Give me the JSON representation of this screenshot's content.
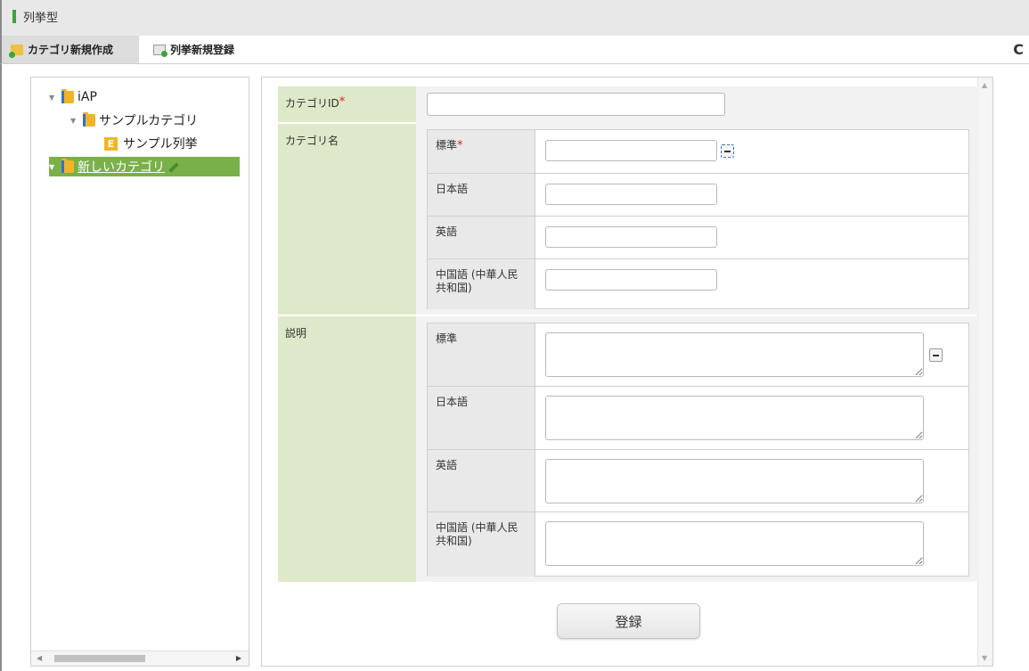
{
  "window": {
    "title": "列挙型"
  },
  "toolbar": {
    "new_category": "カテゴリ新規作成",
    "new_enum": "列挙新規登録",
    "refresh_icon": "refresh-icon"
  },
  "tree": {
    "root": "iAP",
    "category": "サンプルカテゴリ",
    "enum_badge": "E",
    "enum_item": "サンプル列挙",
    "selected": "新しいカテゴリ"
  },
  "form": {
    "category_id_label": "カテゴリID",
    "required_mark": "*",
    "category_name_label": "カテゴリ名",
    "description_label": "説明",
    "lang_standard": "標準",
    "lang_japanese": "日本語",
    "lang_english": "英語",
    "lang_chinese": "中国語 (中華人民共和国)",
    "submit": "登録"
  }
}
